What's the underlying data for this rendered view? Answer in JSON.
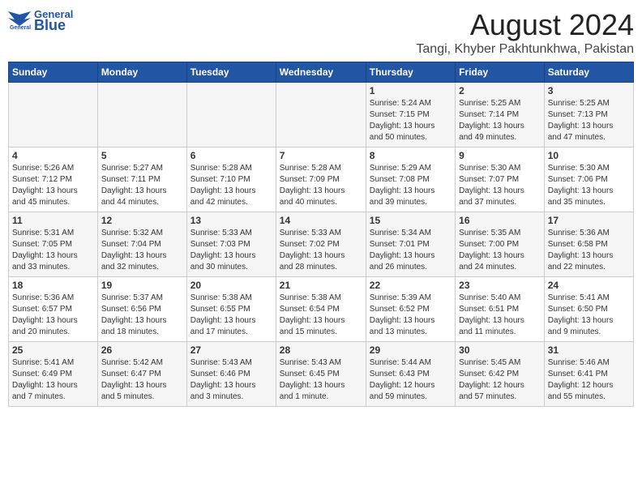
{
  "header": {
    "logo_text1": "General",
    "logo_text2": "Blue",
    "month_year": "August 2024",
    "location": "Tangi, Khyber Pakhtunkhwa, Pakistan"
  },
  "weekdays": [
    "Sunday",
    "Monday",
    "Tuesday",
    "Wednesday",
    "Thursday",
    "Friday",
    "Saturday"
  ],
  "weeks": [
    [
      {
        "day": "",
        "info": ""
      },
      {
        "day": "",
        "info": ""
      },
      {
        "day": "",
        "info": ""
      },
      {
        "day": "",
        "info": ""
      },
      {
        "day": "1",
        "info": "Sunrise: 5:24 AM\nSunset: 7:15 PM\nDaylight: 13 hours\nand 50 minutes."
      },
      {
        "day": "2",
        "info": "Sunrise: 5:25 AM\nSunset: 7:14 PM\nDaylight: 13 hours\nand 49 minutes."
      },
      {
        "day": "3",
        "info": "Sunrise: 5:25 AM\nSunset: 7:13 PM\nDaylight: 13 hours\nand 47 minutes."
      }
    ],
    [
      {
        "day": "4",
        "info": "Sunrise: 5:26 AM\nSunset: 7:12 PM\nDaylight: 13 hours\nand 45 minutes."
      },
      {
        "day": "5",
        "info": "Sunrise: 5:27 AM\nSunset: 7:11 PM\nDaylight: 13 hours\nand 44 minutes."
      },
      {
        "day": "6",
        "info": "Sunrise: 5:28 AM\nSunset: 7:10 PM\nDaylight: 13 hours\nand 42 minutes."
      },
      {
        "day": "7",
        "info": "Sunrise: 5:28 AM\nSunset: 7:09 PM\nDaylight: 13 hours\nand 40 minutes."
      },
      {
        "day": "8",
        "info": "Sunrise: 5:29 AM\nSunset: 7:08 PM\nDaylight: 13 hours\nand 39 minutes."
      },
      {
        "day": "9",
        "info": "Sunrise: 5:30 AM\nSunset: 7:07 PM\nDaylight: 13 hours\nand 37 minutes."
      },
      {
        "day": "10",
        "info": "Sunrise: 5:30 AM\nSunset: 7:06 PM\nDaylight: 13 hours\nand 35 minutes."
      }
    ],
    [
      {
        "day": "11",
        "info": "Sunrise: 5:31 AM\nSunset: 7:05 PM\nDaylight: 13 hours\nand 33 minutes."
      },
      {
        "day": "12",
        "info": "Sunrise: 5:32 AM\nSunset: 7:04 PM\nDaylight: 13 hours\nand 32 minutes."
      },
      {
        "day": "13",
        "info": "Sunrise: 5:33 AM\nSunset: 7:03 PM\nDaylight: 13 hours\nand 30 minutes."
      },
      {
        "day": "14",
        "info": "Sunrise: 5:33 AM\nSunset: 7:02 PM\nDaylight: 13 hours\nand 28 minutes."
      },
      {
        "day": "15",
        "info": "Sunrise: 5:34 AM\nSunset: 7:01 PM\nDaylight: 13 hours\nand 26 minutes."
      },
      {
        "day": "16",
        "info": "Sunrise: 5:35 AM\nSunset: 7:00 PM\nDaylight: 13 hours\nand 24 minutes."
      },
      {
        "day": "17",
        "info": "Sunrise: 5:36 AM\nSunset: 6:58 PM\nDaylight: 13 hours\nand 22 minutes."
      }
    ],
    [
      {
        "day": "18",
        "info": "Sunrise: 5:36 AM\nSunset: 6:57 PM\nDaylight: 13 hours\nand 20 minutes."
      },
      {
        "day": "19",
        "info": "Sunrise: 5:37 AM\nSunset: 6:56 PM\nDaylight: 13 hours\nand 18 minutes."
      },
      {
        "day": "20",
        "info": "Sunrise: 5:38 AM\nSunset: 6:55 PM\nDaylight: 13 hours\nand 17 minutes."
      },
      {
        "day": "21",
        "info": "Sunrise: 5:38 AM\nSunset: 6:54 PM\nDaylight: 13 hours\nand 15 minutes."
      },
      {
        "day": "22",
        "info": "Sunrise: 5:39 AM\nSunset: 6:52 PM\nDaylight: 13 hours\nand 13 minutes."
      },
      {
        "day": "23",
        "info": "Sunrise: 5:40 AM\nSunset: 6:51 PM\nDaylight: 13 hours\nand 11 minutes."
      },
      {
        "day": "24",
        "info": "Sunrise: 5:41 AM\nSunset: 6:50 PM\nDaylight: 13 hours\nand 9 minutes."
      }
    ],
    [
      {
        "day": "25",
        "info": "Sunrise: 5:41 AM\nSunset: 6:49 PM\nDaylight: 13 hours\nand 7 minutes."
      },
      {
        "day": "26",
        "info": "Sunrise: 5:42 AM\nSunset: 6:47 PM\nDaylight: 13 hours\nand 5 minutes."
      },
      {
        "day": "27",
        "info": "Sunrise: 5:43 AM\nSunset: 6:46 PM\nDaylight: 13 hours\nand 3 minutes."
      },
      {
        "day": "28",
        "info": "Sunrise: 5:43 AM\nSunset: 6:45 PM\nDaylight: 13 hours\nand 1 minute."
      },
      {
        "day": "29",
        "info": "Sunrise: 5:44 AM\nSunset: 6:43 PM\nDaylight: 12 hours\nand 59 minutes."
      },
      {
        "day": "30",
        "info": "Sunrise: 5:45 AM\nSunset: 6:42 PM\nDaylight: 12 hours\nand 57 minutes."
      },
      {
        "day": "31",
        "info": "Sunrise: 5:46 AM\nSunset: 6:41 PM\nDaylight: 12 hours\nand 55 minutes."
      }
    ]
  ]
}
